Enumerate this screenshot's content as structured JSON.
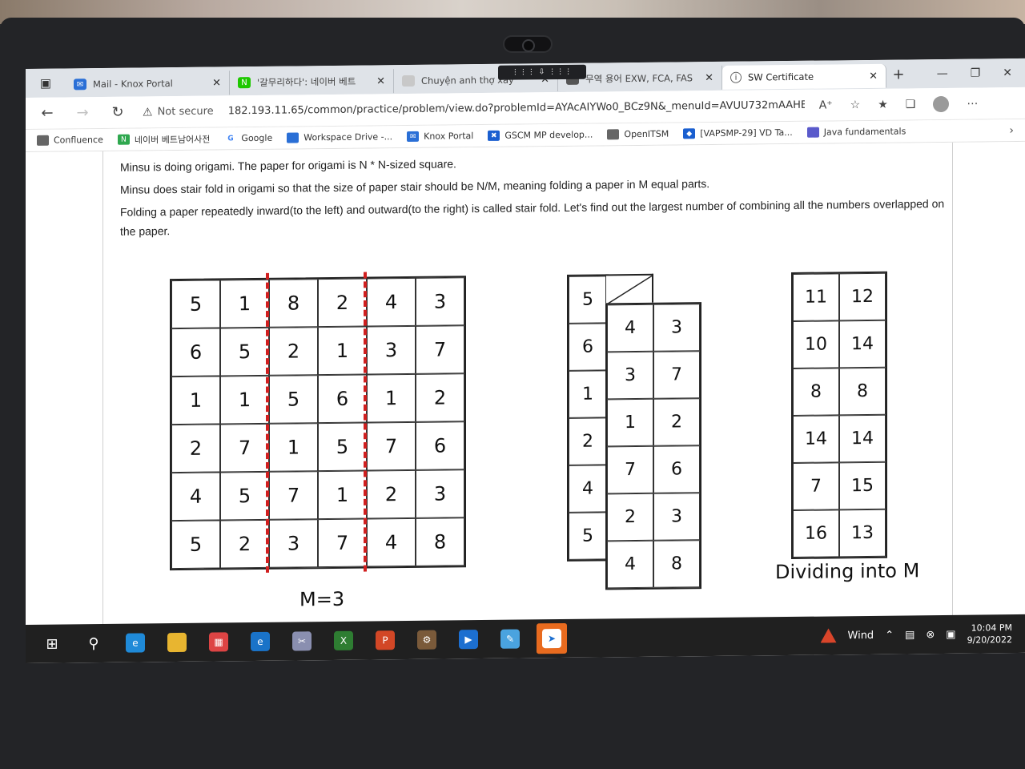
{
  "tabs": [
    {
      "label": "Mail - Knox Portal",
      "color": "#2a6fd6",
      "active": false
    },
    {
      "label": "'갈무리하다': 네이버 베트",
      "color": "#1ec800",
      "active": false
    },
    {
      "label": "Chuyện anh thợ xây",
      "color": "#c8c8c8",
      "active": false
    },
    {
      "label": "무역 용어 EXW, FCA, FAS",
      "color": "#555555",
      "active": false
    },
    {
      "label": "SW Certificate",
      "color": "#555555",
      "active": true
    }
  ],
  "address": {
    "security_label": "Not secure",
    "url": "182.193.11.65/common/practice/problem/view.do?problemId=AYAcAIYWo0_BCz9N&_menuId=AVUU732mAAHBC0c..."
  },
  "favorites": [
    {
      "label": "Confluence",
      "color": "#666666"
    },
    {
      "label": "네이버 베트남어사전",
      "color": "#2fa84f"
    },
    {
      "label": "Google",
      "color": "#4285f4"
    },
    {
      "label": "Workspace Drive -...",
      "color": "#2a6fd6"
    },
    {
      "label": "Knox Portal",
      "color": "#2a6fd6"
    },
    {
      "label": "GSCM MP develop...",
      "color": "#1a5fd0"
    },
    {
      "label": "OpenITSM",
      "color": "#666666"
    },
    {
      "label": "[VAPSMP-29] VD Ta...",
      "color": "#1a5fd0"
    },
    {
      "label": "Java fundamentals",
      "color": "#5a5acb"
    }
  ],
  "problem": {
    "p1": "Minsu is doing origami. The paper for origami is N * N-sized square.",
    "p2": "Minsu does stair fold in origami so that the size of paper stair should be N/M, meaning folding a paper in M equal parts.",
    "p3": "Folding a paper repeatedly inward(to the left) and outward(to the right) is called stair fold. Let's find out the largest number of combining all the numbers overlapped on the paper."
  },
  "grid1": [
    [
      "5",
      "1",
      "8",
      "2",
      "4",
      "3"
    ],
    [
      "6",
      "5",
      "2",
      "1",
      "3",
      "7"
    ],
    [
      "1",
      "1",
      "5",
      "6",
      "1",
      "2"
    ],
    [
      "2",
      "7",
      "1",
      "5",
      "7",
      "6"
    ],
    [
      "4",
      "5",
      "7",
      "1",
      "2",
      "3"
    ],
    [
      "5",
      "2",
      "3",
      "7",
      "4",
      "8"
    ]
  ],
  "grid1_caption": "M=3",
  "grid2_left": [
    "5",
    "6",
    "1",
    "2",
    "4",
    "5"
  ],
  "grid2_right": [
    [
      "4",
      "3"
    ],
    [
      "3",
      "7"
    ],
    [
      "1",
      "2"
    ],
    [
      "7",
      "6"
    ],
    [
      "2",
      "3"
    ],
    [
      "4",
      "8"
    ]
  ],
  "grid3": [
    [
      "11",
      "12"
    ],
    [
      "10",
      "14"
    ],
    [
      "8",
      "8"
    ],
    [
      "14",
      "14"
    ],
    [
      "7",
      "15"
    ],
    [
      "16",
      "13"
    ]
  ],
  "grid3_caption": "Dividing into M",
  "taskbar": {
    "weather": "Wind",
    "time": "10:04 PM",
    "date": "9/20/2022"
  },
  "colors": {
    "fold_line": "#d11f1f",
    "taskbar_active": "#e86b1f"
  }
}
